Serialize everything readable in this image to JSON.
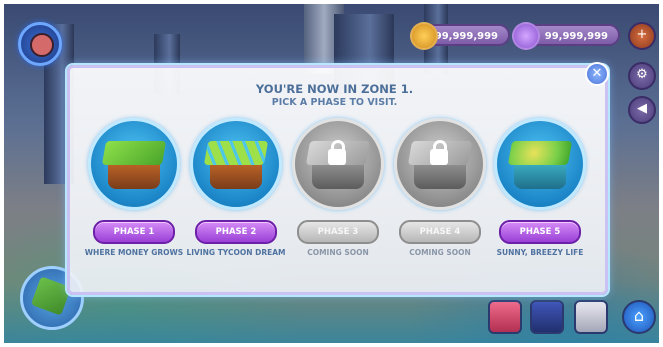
{
  "hud": {
    "coins": "99,999,999",
    "gems": "99,999,999"
  },
  "dialog": {
    "title": "YOU'RE NOW IN ZONE 1.",
    "subtitle": "PICK A PHASE TO VISIT.",
    "close_glyph": "✕"
  },
  "phases": [
    {
      "label": "PHASE 1",
      "description": "WHERE MONEY GROWS",
      "locked": false
    },
    {
      "label": "PHASE 2",
      "description": "LIVING TYCOON DREAM",
      "locked": false
    },
    {
      "label": "PHASE 3",
      "description": "COMING SOON",
      "locked": true
    },
    {
      "label": "PHASE 4",
      "description": "COMING SOON",
      "locked": true
    },
    {
      "label": "PHASE 5",
      "description": "SUNNY, BREEZY LIFE",
      "locked": false
    }
  ],
  "icons": {
    "avatar": "avatar-icon",
    "coin": "coin-icon",
    "gem": "gem-icon",
    "settings": "gear-icon",
    "sound": "speaker-icon",
    "map": "world-map-icon",
    "home": "home-icon"
  },
  "colors": {
    "phase_button_active": "#9a40d6",
    "phase_button_disabled": "#b7b7b7",
    "title_text": "#4c6f9a"
  }
}
